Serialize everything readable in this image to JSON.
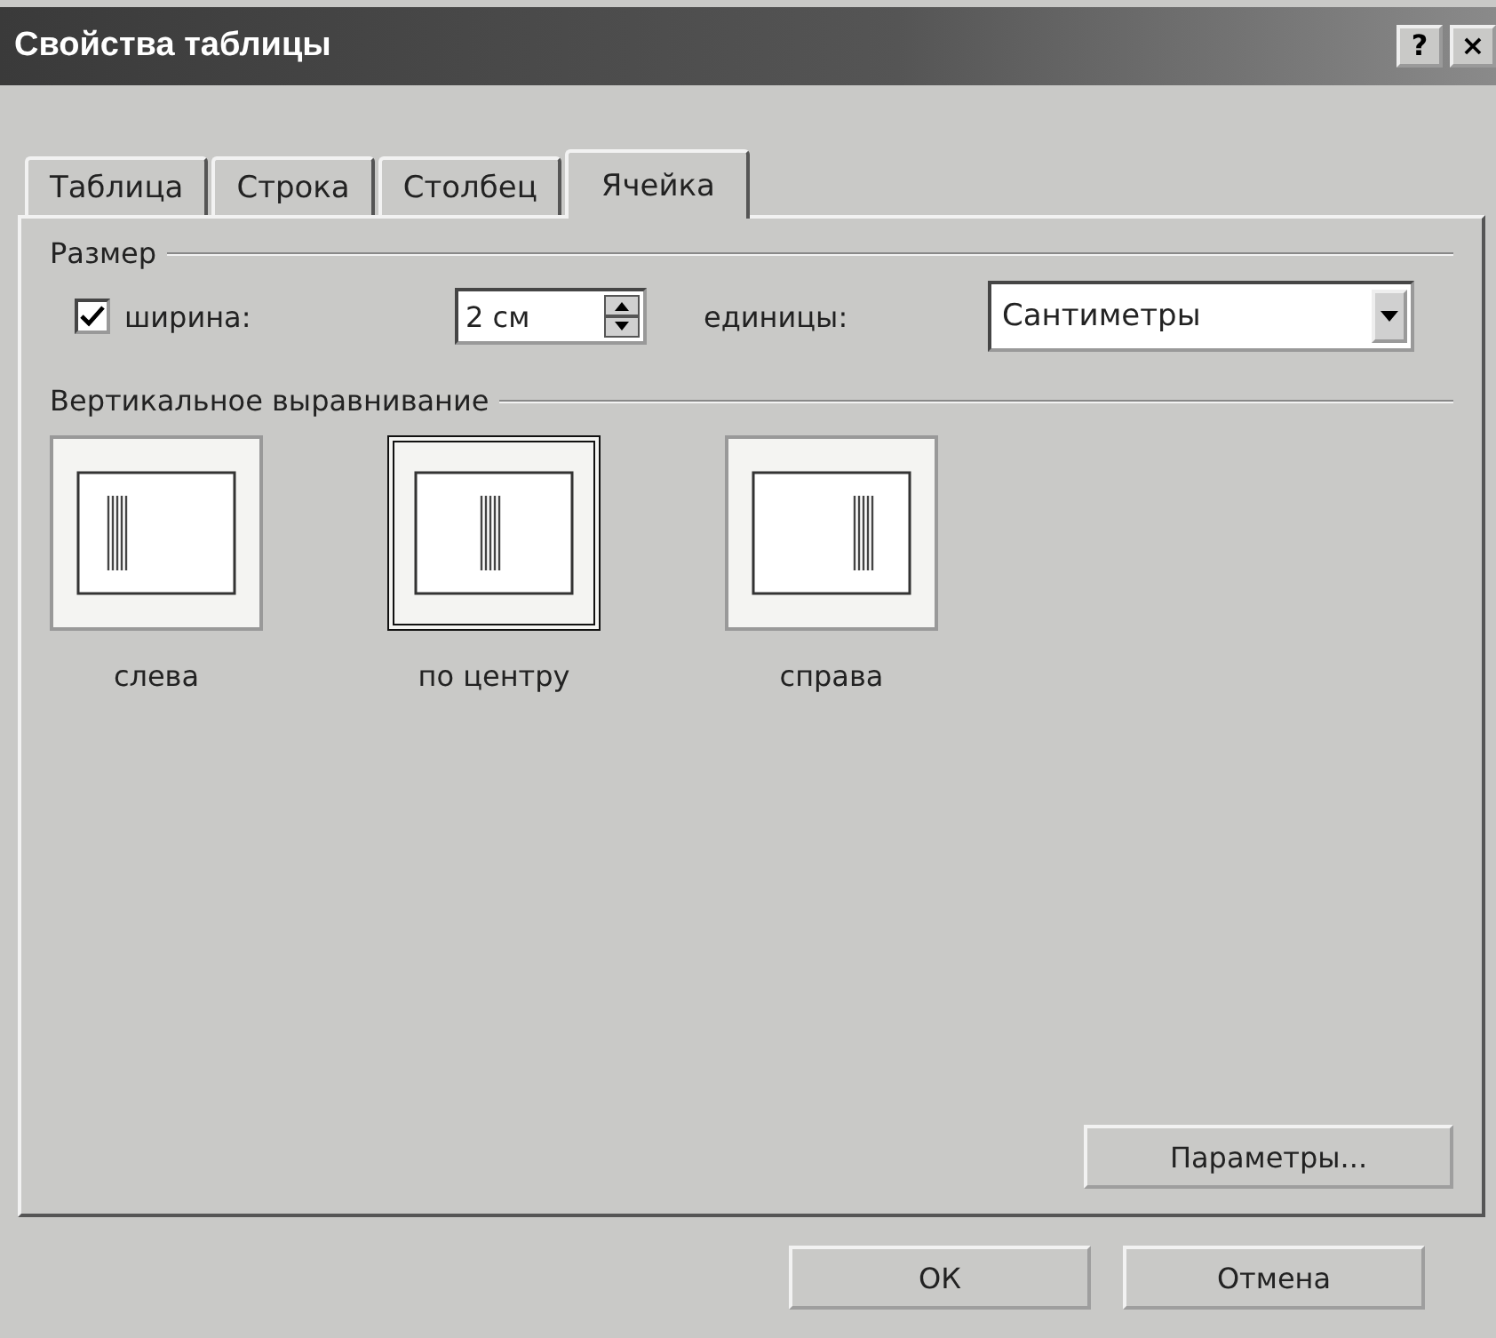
{
  "window": {
    "title": "Свойства таблицы",
    "help": "?",
    "close": "×"
  },
  "tabs": [
    {
      "label": "Таблица",
      "selected": false
    },
    {
      "label": "Строка",
      "selected": false
    },
    {
      "label": "Столбец",
      "selected": false
    },
    {
      "label": "Ячейка",
      "selected": true
    }
  ],
  "size_group": {
    "title": "Размер",
    "width_checkbox": {
      "label": "ширина:",
      "checked": true
    },
    "width_value": "2 см",
    "units_label": "единицы:",
    "units_value": "Сантиметры"
  },
  "alignment_group": {
    "title": "Вертикальное выравнивание",
    "options": [
      {
        "label": "слева",
        "kind": "left",
        "selected": false
      },
      {
        "label": "по центру",
        "kind": "center",
        "selected": true
      },
      {
        "label": "справа",
        "kind": "right",
        "selected": false
      }
    ]
  },
  "options_button": "Параметры...",
  "buttons": [
    "ОК",
    "Отмена"
  ]
}
